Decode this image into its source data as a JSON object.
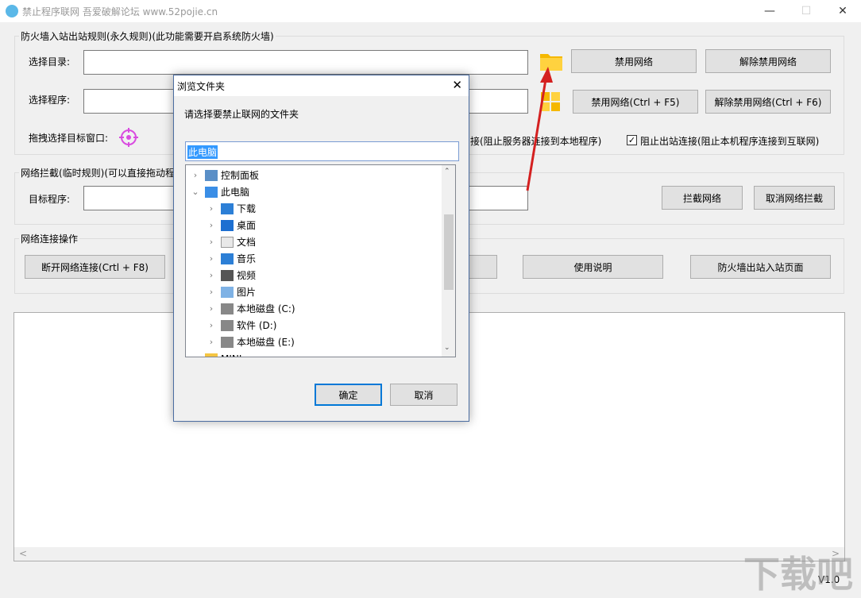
{
  "window": {
    "title": "禁止程序联网 吾爱破解论坛 www.52pojie.cn",
    "minimize": "—",
    "maximize": "☐",
    "close": "✕"
  },
  "firewall_group": {
    "label": "防火墙入站出站规则(永久规则)(此功能需要开启系统防火墙)",
    "select_dir_label": "选择目录:",
    "select_prog_label": "选择程序:",
    "drag_label": "拖拽选择目标窗口:",
    "ban_network": "禁用网络",
    "unban_network": "解除禁用网络",
    "ban_network_hotkey": "禁用网络(Ctrl + F5)",
    "unban_network_hotkey": "解除禁用网络(Ctrl + F6)",
    "inbound_partial": "接(阻止服务器连接到本地程序)",
    "outbound_check": "阻止出站连接(阻止本机程序连接到互联网)",
    "outbound_checked": "✓"
  },
  "intercept_group": {
    "label": "网络拦截(临时规则)(可以直接拖动程",
    "target_label": "目标程序:",
    "intercept": "拦截网络",
    "cancel_intercept": "取消网络拦截"
  },
  "ops_group": {
    "label": "网络连接操作",
    "disconnect": "断开网络连接(Crtl + F8)",
    "usage": "使用说明",
    "firewall_page": "防火墙出站入站页面"
  },
  "footer": {
    "version": "V1.0",
    "scroll_left": "<",
    "scroll_right": ">"
  },
  "dialog": {
    "title": "浏览文件夹",
    "close": "✕",
    "prompt": "请选择要禁止联网的文件夹",
    "path_value": "此电脑",
    "ok": "确定",
    "cancel": "取消",
    "tree": [
      {
        "label": "控制面板",
        "icon": "control-panel-icon",
        "indent": 0,
        "chevron": "›"
      },
      {
        "label": "此电脑",
        "icon": "computer-icon",
        "indent": 0,
        "chevron": "⌄"
      },
      {
        "label": "下载",
        "icon": "download-icon",
        "indent": 1,
        "chevron": "›"
      },
      {
        "label": "桌面",
        "icon": "desktop-icon",
        "indent": 1,
        "chevron": "›"
      },
      {
        "label": "文档",
        "icon": "document-icon",
        "indent": 1,
        "chevron": "›"
      },
      {
        "label": "音乐",
        "icon": "music-icon",
        "indent": 1,
        "chevron": "›"
      },
      {
        "label": "视频",
        "icon": "video-icon",
        "indent": 1,
        "chevron": "›"
      },
      {
        "label": "图片",
        "icon": "picture-icon",
        "indent": 1,
        "chevron": "›"
      },
      {
        "label": "本地磁盘 (C:)",
        "icon": "drive-c-icon",
        "indent": 1,
        "chevron": "›"
      },
      {
        "label": "软件 (D:)",
        "icon": "drive-icon",
        "indent": 1,
        "chevron": "›"
      },
      {
        "label": "本地磁盘 (E:)",
        "icon": "drive-icon",
        "indent": 1,
        "chevron": "›"
      },
      {
        "label": "MINI",
        "icon": "folder-icon",
        "indent": 0,
        "chevron": ""
      }
    ]
  },
  "watermark": "下载吧"
}
